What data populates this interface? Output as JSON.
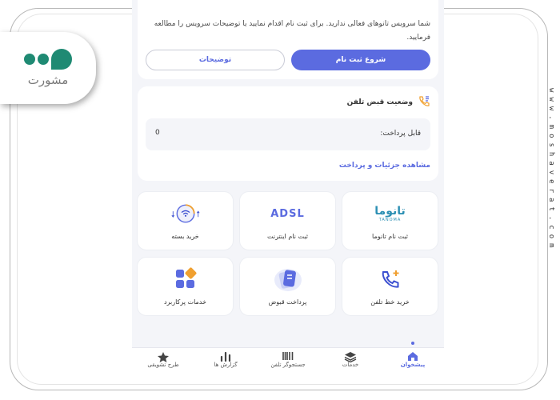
{
  "branding": {
    "logo_text": "مشورت",
    "site_url": "www.moshaverat.com"
  },
  "notice": {
    "text": "شما سرویس تانوهای فعالی ندارید. برای ثبت نام اقدام نمایید یا توضیحات سرویس را مطالعه فرمایید.",
    "primary_button": "شروع ثبت نام",
    "secondary_button": "توضیحات"
  },
  "bill": {
    "title": "وضعیت قبض تلفن",
    "payable_label": "قابل پرداخت:",
    "payable_value": "0",
    "details_link": "مشاهده جزئیات و پرداخت"
  },
  "services": [
    {
      "label": "ثبت نام تانوما",
      "icon": "tanoma-logo-icon",
      "brand_text": "تانوما",
      "brand_sub": "TANOMA"
    },
    {
      "label": "ثبت نام اینترنت",
      "icon": "adsl-icon",
      "brand_text": "ADSL"
    },
    {
      "label": "خرید بسته",
      "icon": "wifi-package-icon"
    },
    {
      "label": "خرید خط تلفن",
      "icon": "phone-plus-icon"
    },
    {
      "label": "پرداخت قبوض",
      "icon": "bill-payment-icon"
    },
    {
      "label": "خدمات پرکاربرد",
      "icon": "grid-services-icon"
    }
  ],
  "bottom_nav": [
    {
      "label": "پیشخوان",
      "icon": "home-icon",
      "active": true
    },
    {
      "label": "خدمات",
      "icon": "layers-icon",
      "active": false
    },
    {
      "label": "جستجوگر تلفن",
      "icon": "barcode-icon",
      "active": false
    },
    {
      "label": "گزارش ها",
      "icon": "bar-chart-icon",
      "active": false
    },
    {
      "label": "طرح تشویقی",
      "icon": "star-icon",
      "active": false
    }
  ],
  "colors": {
    "accent": "#5b6be0",
    "background": "#f4f5f9",
    "logo_green": "#1f8a73",
    "wifi_ring": "#f0a030"
  }
}
